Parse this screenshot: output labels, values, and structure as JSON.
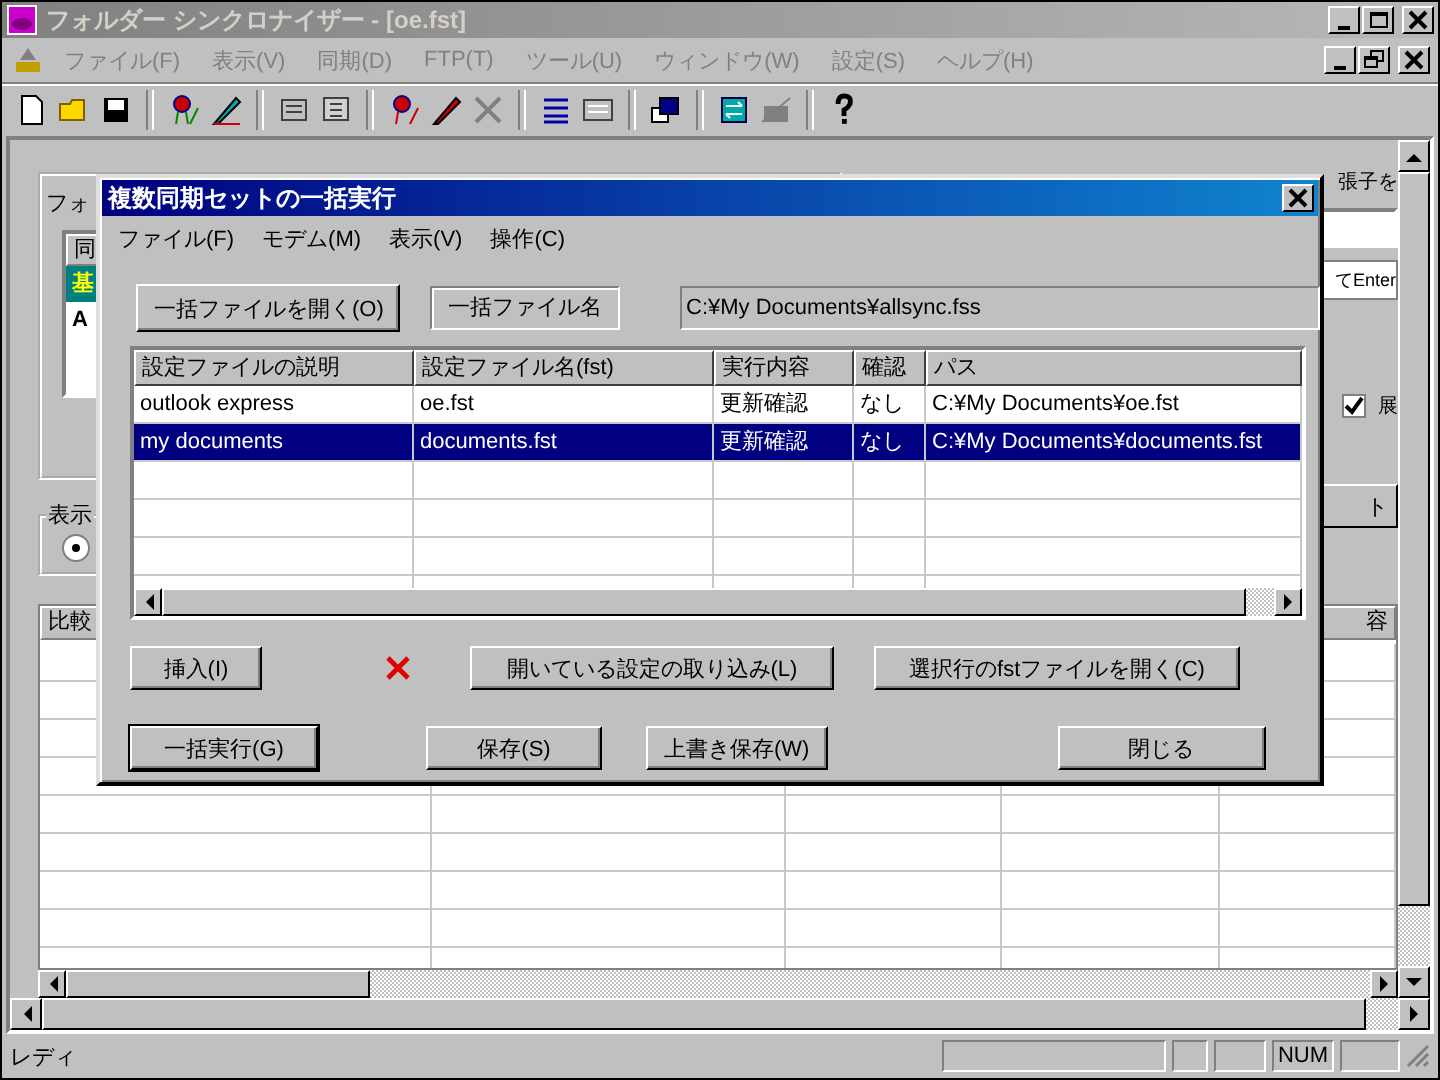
{
  "window": {
    "title": "フォルダー シンクロナイザー - [oe.fst]"
  },
  "menu": [
    {
      "label": "ファイル(F)",
      "disabled": true
    },
    {
      "label": "表示(V)",
      "disabled": true
    },
    {
      "label": "同期(D)",
      "disabled": true
    },
    {
      "label": "FTP(T)",
      "disabled": true
    },
    {
      "label": "ツール(U)",
      "disabled": true
    },
    {
      "label": "ウィンドウ(W)",
      "disabled": true
    },
    {
      "label": "設定(S)",
      "disabled": true
    },
    {
      "label": "ヘルプ(H)",
      "disabled": true
    }
  ],
  "folder_group": {
    "field_label": "フォ",
    "list_header": "同",
    "list_rows": [
      {
        "text": "基",
        "selected": true
      },
      {
        "text": "A",
        "selected": false
      }
    ]
  },
  "display_group": {
    "label": "表示",
    "radio_selected": true
  },
  "extension_group": {
    "label": "張子を",
    "enter_field": "てEnter",
    "checkbox_label": "展",
    "checked": true,
    "button_label": "ト"
  },
  "compare_table": {
    "column_1": "比較",
    "column_5": "容"
  },
  "dialog": {
    "title": "複数同期セットの一括実行",
    "menu": [
      "ファイル(F)",
      "モデム(M)",
      "表示(V)",
      "操作(C)"
    ],
    "open_button": "一括ファイルを開く(O)",
    "file_label": "一括ファイル名",
    "file_path": "C:¥My Documents¥allsync.fss",
    "columns": [
      "設定ファイルの説明",
      "設定ファイル名(fst)",
      "実行内容",
      "確認",
      "パス"
    ],
    "rows": [
      {
        "cells": [
          "outlook express",
          "oe.fst",
          "更新確認",
          "なし",
          "C:¥My Documents¥oe.fst"
        ],
        "selected": false
      },
      {
        "cells": [
          "my documents",
          "documents.fst",
          "更新確認",
          "なし",
          "C:¥My Documents¥documents.fst"
        ],
        "selected": true
      }
    ],
    "buttons_top": [
      {
        "kind": "button",
        "label": "挿入(I)"
      },
      {
        "kind": "delete"
      },
      {
        "kind": "button",
        "label": "開いている設定の取り込み(L)"
      },
      {
        "kind": "button",
        "label": "選択行のfstファイルを開く(C)"
      }
    ],
    "buttons_bottom": [
      {
        "label": "一括実行(G)",
        "default": true
      },
      {
        "label": "保存(S)",
        "default": false
      },
      {
        "label": "上書き保存(W)",
        "default": false
      },
      {
        "label": "閉じる",
        "default": false
      }
    ]
  },
  "status_bar": {
    "text": "レディ",
    "num_indicator": "NUM"
  }
}
